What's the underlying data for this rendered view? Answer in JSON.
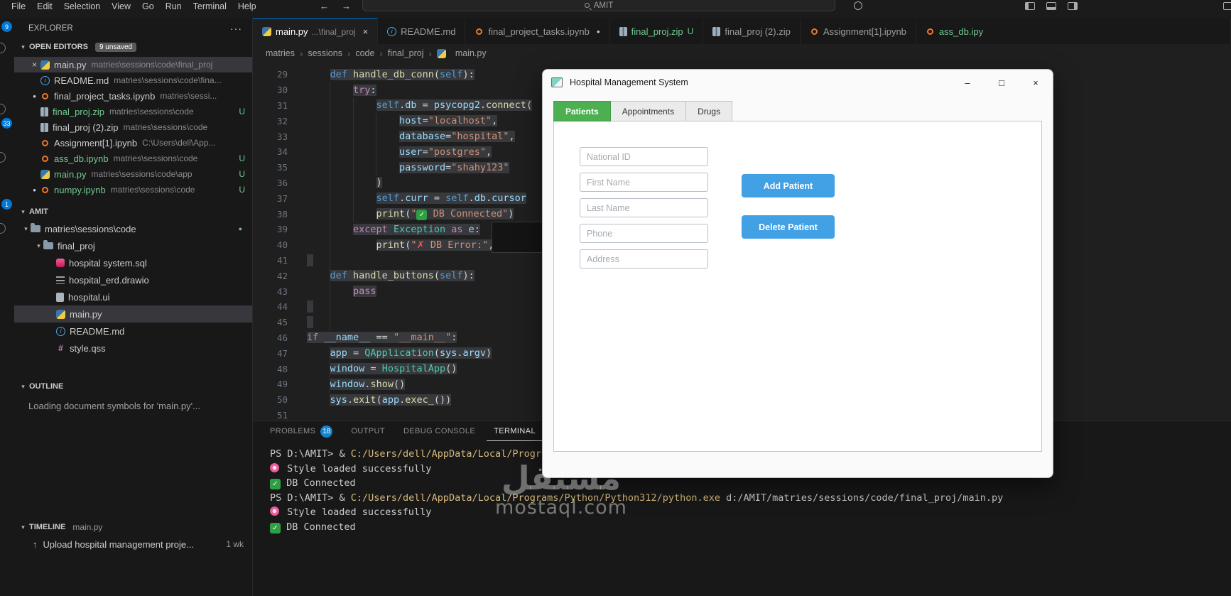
{
  "icons": {
    "close": "×",
    "dot": "●",
    "chevron_down": "▾",
    "chevron_right": "›",
    "more": "···",
    "upload": "↑",
    "check": "✓",
    "cross": "✗",
    "minimize": "–",
    "maximize": "□"
  },
  "titlebar": {
    "menus": [
      "File",
      "Edit",
      "Selection",
      "View",
      "Go",
      "Run",
      "Terminal",
      "Help"
    ],
    "nav_back": "←",
    "nav_forward": "→",
    "search_value": "AMIT"
  },
  "activity_bar": {
    "badges": [
      {
        "value": "9"
      },
      {
        "value": "33"
      },
      {
        "value": "1"
      }
    ]
  },
  "sidebar": {
    "title": "EXPLORER",
    "open_editors": {
      "label": "OPEN EDITORS",
      "badge": "9 unsaved",
      "items": [
        {
          "icon": "python",
          "name": "main.py",
          "path": "matries\\sessions\\code\\final_proj",
          "active": true
        },
        {
          "icon": "info",
          "name": "README.md",
          "path": "matries\\sessions\\code\\fina..."
        },
        {
          "icon": "notebook",
          "name": "final_project_tasks.ipynb",
          "path": "matries\\sessi...",
          "modified": true
        },
        {
          "icon": "zip",
          "name": "final_proj.zip",
          "path": "matries\\sessions\\code",
          "git": "U",
          "untracked": true
        },
        {
          "icon": "zip",
          "name": "final_proj (2).zip",
          "path": "matries\\sessions\\code"
        },
        {
          "icon": "notebook",
          "name": "Assignment[1].ipynb",
          "path": "C:\\Users\\dell\\App..."
        },
        {
          "icon": "notebook",
          "name": "ass_db.ipynb",
          "path": "matries\\sessions\\code",
          "git": "U",
          "untracked": true
        },
        {
          "icon": "python",
          "name": "main.py",
          "path": "matries\\sessions\\code\\app",
          "git": "U",
          "untracked": true
        },
        {
          "icon": "notebook",
          "name": "numpy.ipynb",
          "path": "matries\\sessions\\code",
          "git": "U",
          "untracked": true,
          "modified": true
        }
      ]
    },
    "workspace": {
      "label": "AMIT",
      "tree": [
        {
          "icon": "folder",
          "type": "folder",
          "name": "matries\\sessions\\code",
          "level": 0,
          "dot": true
        },
        {
          "icon": "folder",
          "type": "folder",
          "name": "final_proj",
          "level": 1
        },
        {
          "icon": "sql",
          "type": "file",
          "name": "hospital system.sql",
          "level": 2
        },
        {
          "icon": "drawio",
          "type": "file",
          "name": "hospital_erd.drawio",
          "level": 2
        },
        {
          "icon": "ui",
          "type": "file",
          "name": "hospital.ui",
          "level": 2
        },
        {
          "icon": "python",
          "type": "file",
          "name": "main.py",
          "level": 2,
          "selected": true
        },
        {
          "icon": "info",
          "type": "file",
          "name": "README.md",
          "level": 2
        },
        {
          "icon": "qss",
          "type": "file",
          "name": "style.qss",
          "level": 2
        }
      ]
    },
    "outline": {
      "label": "OUTLINE",
      "message": "Loading document symbols for 'main.py'..."
    },
    "timeline": {
      "label": "TIMELINE",
      "file": "main.py",
      "items": [
        {
          "label": "Upload hospital management proje...",
          "time": "1 wk"
        }
      ]
    }
  },
  "editor_tabs": [
    {
      "icon": "python",
      "name": "main.py",
      "dim": "...\\final_proj",
      "active": true,
      "close": true
    },
    {
      "icon": "info",
      "name": "README.md"
    },
    {
      "icon": "notebook",
      "name": "final_project_tasks.ipynb",
      "modified": true
    },
    {
      "icon": "zip",
      "name": "final_proj.zip",
      "git": "U",
      "untracked": true
    },
    {
      "icon": "zip",
      "name": "final_proj (2).zip"
    },
    {
      "icon": "notebook",
      "name": "Assignment[1].ipynb"
    },
    {
      "icon": "notebook",
      "name": "ass_db.ipy",
      "untracked": true
    }
  ],
  "breadcrumb": [
    "matries",
    "sessions",
    "code",
    "final_proj",
    "main.py"
  ],
  "code": {
    "lines": [
      {
        "n": 29,
        "indent": 4,
        "sel": true,
        "tokens": [
          [
            "def ",
            "def"
          ],
          [
            "handle_db_conn",
            "fn"
          ],
          [
            "(",
            "txt"
          ],
          [
            "self",
            "self"
          ],
          [
            "):",
            "txt"
          ]
        ]
      },
      {
        "n": 30,
        "indent": 8,
        "sel": true,
        "tokens": [
          [
            "try",
            "kw"
          ],
          [
            ":",
            "txt"
          ]
        ]
      },
      {
        "n": 31,
        "indent": 12,
        "sel": true,
        "tokens": [
          [
            "self",
            "self"
          ],
          [
            ".",
            "txt"
          ],
          [
            "db",
            "var"
          ],
          [
            " = ",
            "txt"
          ],
          [
            "psycopg2",
            "var"
          ],
          [
            ".",
            "txt"
          ],
          [
            "connect",
            "fn"
          ],
          [
            "(",
            "txt"
          ]
        ]
      },
      {
        "n": 32,
        "indent": 16,
        "sel": true,
        "tokens": [
          [
            "host",
            "var"
          ],
          [
            "=",
            "txt"
          ],
          [
            "\"localhost\"",
            "str"
          ],
          [
            ",",
            "txt"
          ]
        ]
      },
      {
        "n": 33,
        "indent": 16,
        "sel": true,
        "tokens": [
          [
            "database",
            "var"
          ],
          [
            "=",
            "txt"
          ],
          [
            "\"hospital\"",
            "str"
          ],
          [
            ",",
            "txt"
          ]
        ]
      },
      {
        "n": 34,
        "indent": 16,
        "sel": true,
        "tokens": [
          [
            "user",
            "var"
          ],
          [
            "=",
            "txt"
          ],
          [
            "\"postgres\"",
            "str"
          ],
          [
            ",",
            "txt"
          ]
        ]
      },
      {
        "n": 35,
        "indent": 16,
        "sel": true,
        "tokens": [
          [
            "password",
            "var"
          ],
          [
            "=",
            "txt"
          ],
          [
            "\"shahy123\"",
            "str"
          ]
        ]
      },
      {
        "n": 36,
        "indent": 12,
        "sel": true,
        "tokens": [
          [
            ")",
            "txt"
          ]
        ]
      },
      {
        "n": 37,
        "indent": 12,
        "sel": true,
        "tokens": [
          [
            "self",
            "self"
          ],
          [
            ".",
            "txt"
          ],
          [
            "curr",
            "var"
          ],
          [
            " = ",
            "txt"
          ],
          [
            "self",
            "self"
          ],
          [
            ".",
            "txt"
          ],
          [
            "db",
            "var"
          ],
          [
            ".",
            "txt"
          ],
          [
            "cursor",
            "var"
          ]
        ]
      },
      {
        "n": 38,
        "indent": 12,
        "sel": true,
        "tokens": [
          [
            "print",
            "fn"
          ],
          [
            "(",
            "txt"
          ],
          [
            "\"",
            "str"
          ],
          [
            "✓",
            "echeck"
          ],
          [
            " DB Connected\"",
            "str"
          ],
          [
            ")",
            "txt"
          ]
        ]
      },
      {
        "n": 39,
        "indent": 8,
        "sel": true,
        "tokens": [
          [
            "except ",
            "kw"
          ],
          [
            "Exception",
            "cls"
          ],
          [
            " as ",
            "kw"
          ],
          [
            "e",
            "var"
          ],
          [
            ":",
            "txt"
          ]
        ]
      },
      {
        "n": 40,
        "indent": 12,
        "sel": true,
        "tokens": [
          [
            "print",
            "fn"
          ],
          [
            "(",
            "txt"
          ],
          [
            "\"",
            "str"
          ],
          [
            "✗",
            "ex"
          ],
          [
            " DB Error:\"",
            "str"
          ],
          [
            ", ",
            "txt"
          ],
          [
            "e",
            "var"
          ],
          [
            ")",
            "txt"
          ]
        ]
      },
      {
        "n": 41,
        "stub": true
      },
      {
        "n": 42,
        "indent": 4,
        "sel": true,
        "tokens": [
          [
            "def ",
            "def"
          ],
          [
            "handle_buttons",
            "fn"
          ],
          [
            "(",
            "txt"
          ],
          [
            "self",
            "self"
          ],
          [
            "):",
            "txt"
          ]
        ]
      },
      {
        "n": 43,
        "indent": 8,
        "sel": true,
        "tokens": [
          [
            "pass",
            "kw"
          ]
        ]
      },
      {
        "n": 44,
        "stub": true
      },
      {
        "n": 45,
        "stub": true
      },
      {
        "n": 46,
        "indent": 0,
        "sel": true,
        "tokens": [
          [
            "if ",
            "kw"
          ],
          [
            "__name__",
            "var"
          ],
          [
            " == ",
            "txt"
          ],
          [
            "\"__main__\"",
            "str"
          ],
          [
            ":",
            "txt"
          ]
        ]
      },
      {
        "n": 47,
        "indent": 4,
        "sel": true,
        "tokens": [
          [
            "app",
            "var"
          ],
          [
            " = ",
            "txt"
          ],
          [
            "QApplication",
            "cls"
          ],
          [
            "(",
            "txt"
          ],
          [
            "sys",
            "var"
          ],
          [
            ".",
            "txt"
          ],
          [
            "argv",
            "var"
          ],
          [
            ")",
            "txt"
          ]
        ]
      },
      {
        "n": 48,
        "indent": 4,
        "sel": true,
        "tokens": [
          [
            "window",
            "var"
          ],
          [
            " = ",
            "txt"
          ],
          [
            "HospitalApp",
            "cls"
          ],
          [
            "()",
            "txt"
          ]
        ]
      },
      {
        "n": 49,
        "indent": 4,
        "sel": true,
        "tokens": [
          [
            "window",
            "var"
          ],
          [
            ".",
            "txt"
          ],
          [
            "show",
            "fn"
          ],
          [
            "()",
            "txt"
          ]
        ]
      },
      {
        "n": 50,
        "indent": 4,
        "sel": true,
        "tokens": [
          [
            "sys",
            "var"
          ],
          [
            ".",
            "txt"
          ],
          [
            "exit",
            "fn"
          ],
          [
            "(",
            "txt"
          ],
          [
            "app",
            "var"
          ],
          [
            ".",
            "txt"
          ],
          [
            "exec_",
            "fn"
          ],
          [
            "())",
            "txt"
          ]
        ]
      },
      {
        "n": 51,
        "tokens": []
      }
    ]
  },
  "panel": {
    "tabs": [
      {
        "label": "PROBLEMS",
        "badge": "18"
      },
      {
        "label": "OUTPUT"
      },
      {
        "label": "DEBUG CONSOLE"
      },
      {
        "label": "TERMINAL",
        "active": true
      }
    ],
    "terminal": [
      [
        [
          "PS D:\\AMIT> & ",
          "t"
        ],
        [
          "C:/Users/dell/AppData/Local/Progr",
          "path"
        ]
      ],
      [
        [
          "",
          "flower"
        ],
        [
          " Style loaded successfully",
          "t"
        ]
      ],
      [
        [
          "✓",
          "echeck"
        ],
        [
          " DB Connected",
          "t"
        ]
      ],
      [
        [
          "PS D:\\AMIT> & ",
          "t"
        ],
        [
          "C:/Users/dell/AppData/Local/Programs/Python/Python312/python.exe",
          "path"
        ],
        [
          " d:/AMIT/matries/sessions/code/final_proj/main.py",
          "t"
        ]
      ],
      [
        [
          "",
          "flower"
        ],
        [
          " Style loaded successfully",
          "t"
        ]
      ],
      [
        [
          "✓",
          "echeck"
        ],
        [
          " DB Connected",
          "t"
        ]
      ]
    ]
  },
  "hospital_app": {
    "title": "Hospital Management System",
    "window_controls": [
      "–",
      "□",
      "×"
    ],
    "tabs": [
      {
        "label": "Patients",
        "active": true
      },
      {
        "label": "Appointments"
      },
      {
        "label": "Drugs"
      }
    ],
    "fields": [
      {
        "placeholder": "National ID"
      },
      {
        "placeholder": "First Name"
      },
      {
        "placeholder": "Last Name"
      },
      {
        "placeholder": "Phone"
      },
      {
        "placeholder": "Address"
      }
    ],
    "buttons": [
      {
        "label": "Add Patient"
      },
      {
        "label": "Delete Patient"
      }
    ],
    "colors": {
      "active_tab": "#4caf50",
      "button": "#42a0e5"
    }
  },
  "watermark": {
    "arabic": "مستقل",
    "latin": "mostaql.com"
  }
}
